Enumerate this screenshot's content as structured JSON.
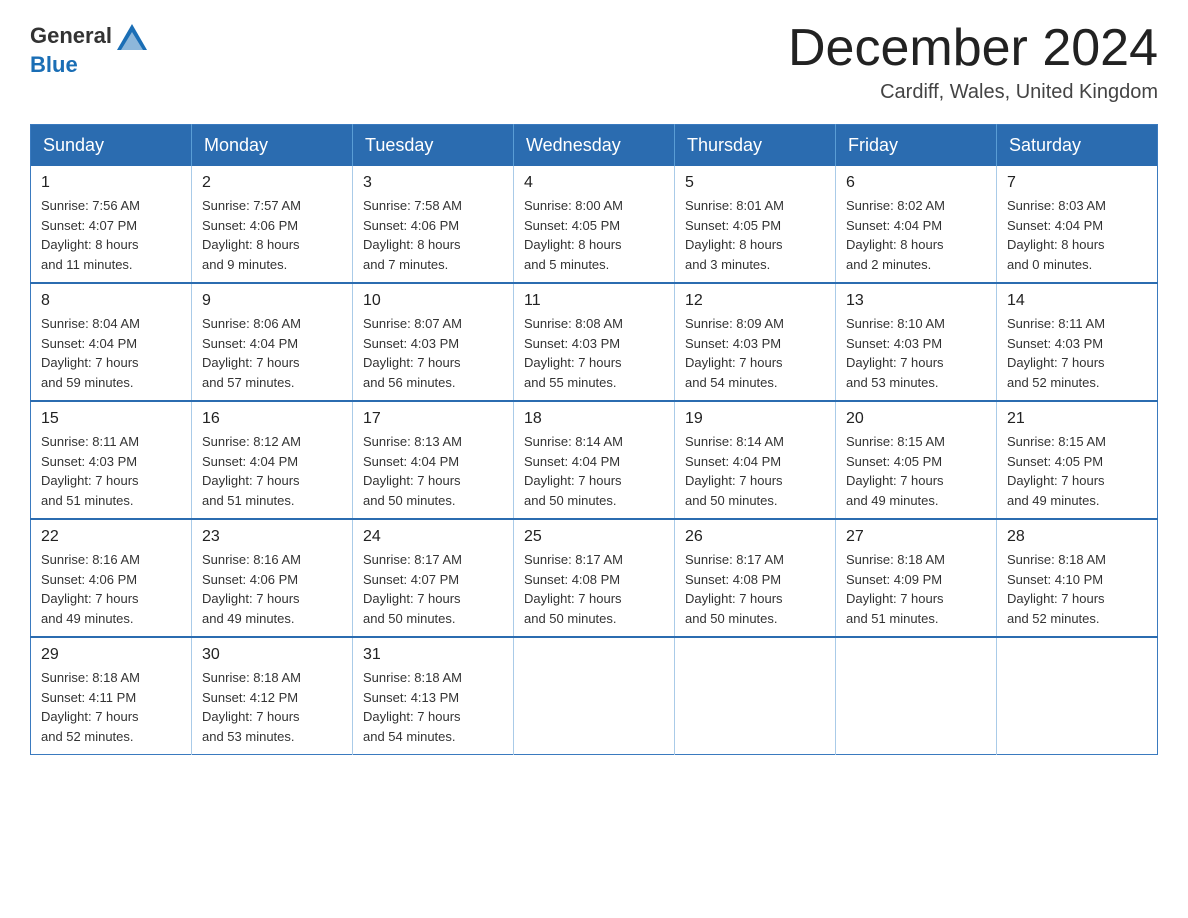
{
  "header": {
    "logo_general": "General",
    "logo_blue": "Blue",
    "month_title": "December 2024",
    "location": "Cardiff, Wales, United Kingdom"
  },
  "weekdays": [
    "Sunday",
    "Monday",
    "Tuesday",
    "Wednesday",
    "Thursday",
    "Friday",
    "Saturday"
  ],
  "weeks": [
    [
      {
        "day": "1",
        "info": "Sunrise: 7:56 AM\nSunset: 4:07 PM\nDaylight: 8 hours\nand 11 minutes."
      },
      {
        "day": "2",
        "info": "Sunrise: 7:57 AM\nSunset: 4:06 PM\nDaylight: 8 hours\nand 9 minutes."
      },
      {
        "day": "3",
        "info": "Sunrise: 7:58 AM\nSunset: 4:06 PM\nDaylight: 8 hours\nand 7 minutes."
      },
      {
        "day": "4",
        "info": "Sunrise: 8:00 AM\nSunset: 4:05 PM\nDaylight: 8 hours\nand 5 minutes."
      },
      {
        "day": "5",
        "info": "Sunrise: 8:01 AM\nSunset: 4:05 PM\nDaylight: 8 hours\nand 3 minutes."
      },
      {
        "day": "6",
        "info": "Sunrise: 8:02 AM\nSunset: 4:04 PM\nDaylight: 8 hours\nand 2 minutes."
      },
      {
        "day": "7",
        "info": "Sunrise: 8:03 AM\nSunset: 4:04 PM\nDaylight: 8 hours\nand 0 minutes."
      }
    ],
    [
      {
        "day": "8",
        "info": "Sunrise: 8:04 AM\nSunset: 4:04 PM\nDaylight: 7 hours\nand 59 minutes."
      },
      {
        "day": "9",
        "info": "Sunrise: 8:06 AM\nSunset: 4:04 PM\nDaylight: 7 hours\nand 57 minutes."
      },
      {
        "day": "10",
        "info": "Sunrise: 8:07 AM\nSunset: 4:03 PM\nDaylight: 7 hours\nand 56 minutes."
      },
      {
        "day": "11",
        "info": "Sunrise: 8:08 AM\nSunset: 4:03 PM\nDaylight: 7 hours\nand 55 minutes."
      },
      {
        "day": "12",
        "info": "Sunrise: 8:09 AM\nSunset: 4:03 PM\nDaylight: 7 hours\nand 54 minutes."
      },
      {
        "day": "13",
        "info": "Sunrise: 8:10 AM\nSunset: 4:03 PM\nDaylight: 7 hours\nand 53 minutes."
      },
      {
        "day": "14",
        "info": "Sunrise: 8:11 AM\nSunset: 4:03 PM\nDaylight: 7 hours\nand 52 minutes."
      }
    ],
    [
      {
        "day": "15",
        "info": "Sunrise: 8:11 AM\nSunset: 4:03 PM\nDaylight: 7 hours\nand 51 minutes."
      },
      {
        "day": "16",
        "info": "Sunrise: 8:12 AM\nSunset: 4:04 PM\nDaylight: 7 hours\nand 51 minutes."
      },
      {
        "day": "17",
        "info": "Sunrise: 8:13 AM\nSunset: 4:04 PM\nDaylight: 7 hours\nand 50 minutes."
      },
      {
        "day": "18",
        "info": "Sunrise: 8:14 AM\nSunset: 4:04 PM\nDaylight: 7 hours\nand 50 minutes."
      },
      {
        "day": "19",
        "info": "Sunrise: 8:14 AM\nSunset: 4:04 PM\nDaylight: 7 hours\nand 50 minutes."
      },
      {
        "day": "20",
        "info": "Sunrise: 8:15 AM\nSunset: 4:05 PM\nDaylight: 7 hours\nand 49 minutes."
      },
      {
        "day": "21",
        "info": "Sunrise: 8:15 AM\nSunset: 4:05 PM\nDaylight: 7 hours\nand 49 minutes."
      }
    ],
    [
      {
        "day": "22",
        "info": "Sunrise: 8:16 AM\nSunset: 4:06 PM\nDaylight: 7 hours\nand 49 minutes."
      },
      {
        "day": "23",
        "info": "Sunrise: 8:16 AM\nSunset: 4:06 PM\nDaylight: 7 hours\nand 49 minutes."
      },
      {
        "day": "24",
        "info": "Sunrise: 8:17 AM\nSunset: 4:07 PM\nDaylight: 7 hours\nand 50 minutes."
      },
      {
        "day": "25",
        "info": "Sunrise: 8:17 AM\nSunset: 4:08 PM\nDaylight: 7 hours\nand 50 minutes."
      },
      {
        "day": "26",
        "info": "Sunrise: 8:17 AM\nSunset: 4:08 PM\nDaylight: 7 hours\nand 50 minutes."
      },
      {
        "day": "27",
        "info": "Sunrise: 8:18 AM\nSunset: 4:09 PM\nDaylight: 7 hours\nand 51 minutes."
      },
      {
        "day": "28",
        "info": "Sunrise: 8:18 AM\nSunset: 4:10 PM\nDaylight: 7 hours\nand 52 minutes."
      }
    ],
    [
      {
        "day": "29",
        "info": "Sunrise: 8:18 AM\nSunset: 4:11 PM\nDaylight: 7 hours\nand 52 minutes."
      },
      {
        "day": "30",
        "info": "Sunrise: 8:18 AM\nSunset: 4:12 PM\nDaylight: 7 hours\nand 53 minutes."
      },
      {
        "day": "31",
        "info": "Sunrise: 8:18 AM\nSunset: 4:13 PM\nDaylight: 7 hours\nand 54 minutes."
      },
      {
        "day": "",
        "info": ""
      },
      {
        "day": "",
        "info": ""
      },
      {
        "day": "",
        "info": ""
      },
      {
        "day": "",
        "info": ""
      }
    ]
  ]
}
